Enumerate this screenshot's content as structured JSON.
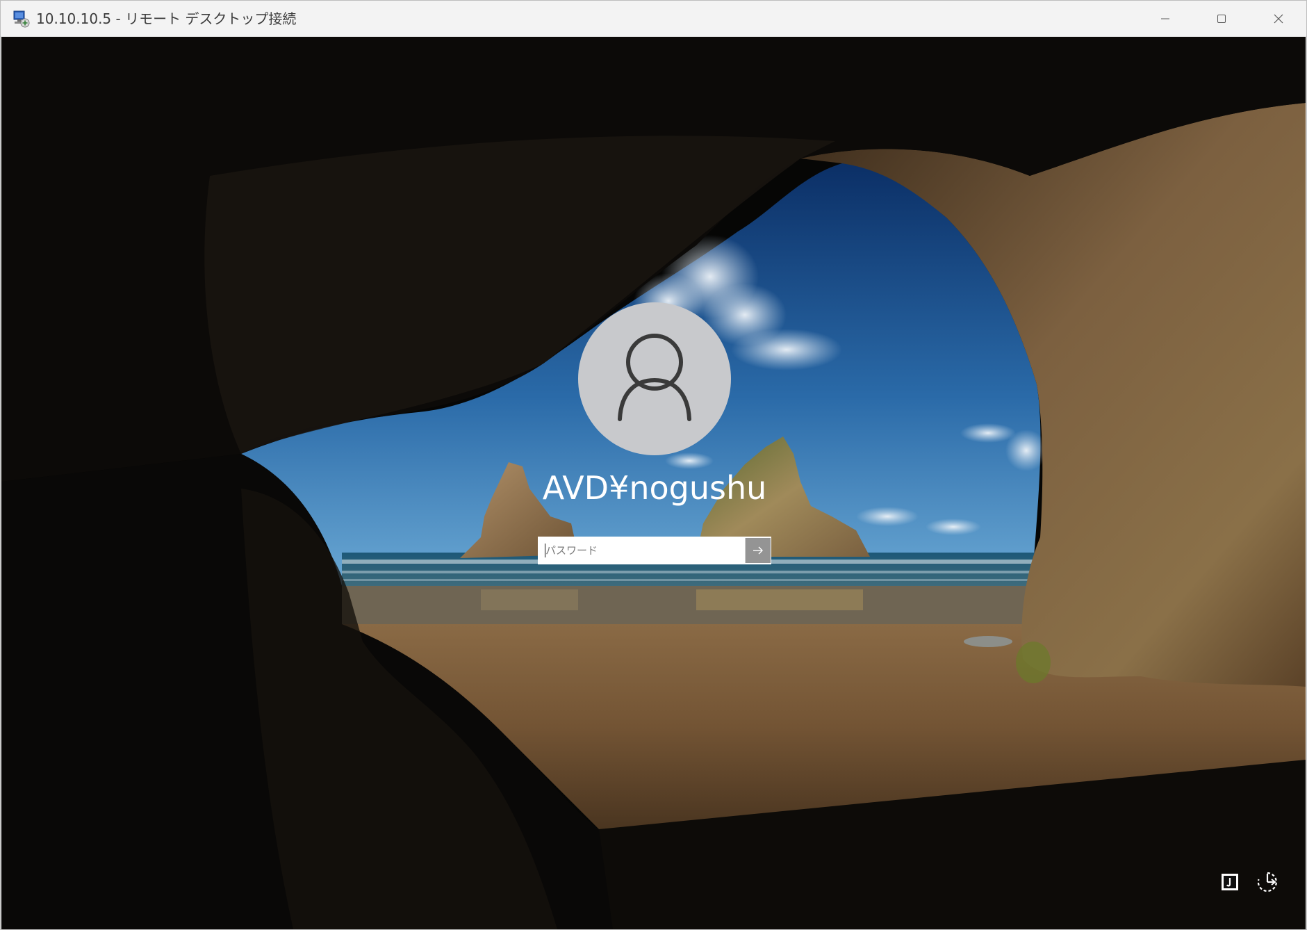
{
  "window": {
    "title": "10.10.10.5 - リモート デスクトップ接続",
    "app_icon": "remote-desktop-icon",
    "controls": {
      "minimize_icon": "minimize-icon",
      "maximize_icon": "maximize-icon",
      "close_icon": "close-icon"
    }
  },
  "signin": {
    "avatar_icon": "user-icon",
    "username": "AVD¥nogushu",
    "password_placeholder": "パスワード",
    "submit_icon": "arrow-right-icon"
  },
  "tray": {
    "language_icon": "input-language-icon",
    "accessibility_icon": "accessibility-icon"
  },
  "colors": {
    "titlebar": "#f3f3f3",
    "avatar_bg": "#c8c9cc",
    "text_on_wallpaper": "#ffffff"
  }
}
